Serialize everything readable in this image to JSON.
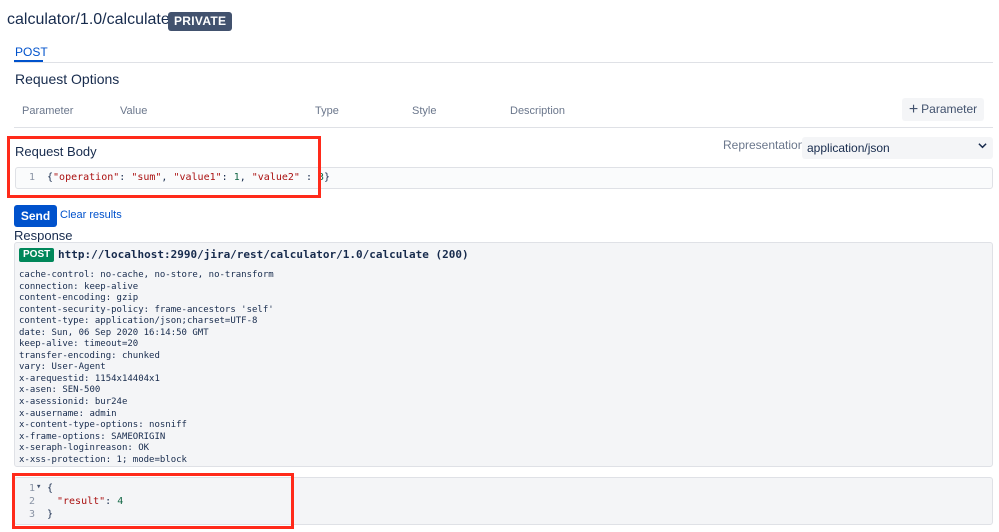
{
  "header": {
    "title": "calculator/1.0/calculate",
    "badge": "PRIVATE"
  },
  "tabs": [
    {
      "label": "POST",
      "active": true
    }
  ],
  "request_options": {
    "title": "Request Options",
    "columns": [
      "Parameter",
      "Value",
      "Type",
      "Style",
      "Description"
    ],
    "add_button": "Parameter"
  },
  "request_body": {
    "title": "Request Body",
    "representation_label": "Representation",
    "representation_value": "application/json",
    "line_number": "1",
    "tokens": {
      "open": "{",
      "k1": "\"operation\"",
      "c1": ": ",
      "v1": "\"sum\"",
      "sep1": ", ",
      "k2": "\"value1\"",
      "c2": ": ",
      "v2": "1",
      "sep2": ", ",
      "k3": "\"value2\"",
      "c3": " : ",
      "v3": "3",
      "close": "}"
    }
  },
  "actions": {
    "send": "Send",
    "clear": "Clear results"
  },
  "response": {
    "title": "Response",
    "method": "POST",
    "url_status": "http://localhost:2990/jira/rest/calculator/1.0/calculate (200)",
    "headers": [
      "cache-control: no-cache, no-store, no-transform",
      "connection: keep-alive",
      "content-encoding: gzip",
      "content-security-policy: frame-ancestors 'self'",
      "content-type: application/json;charset=UTF-8",
      "date: Sun, 06 Sep 2020 16:14:50 GMT",
      "keep-alive: timeout=20",
      "transfer-encoding: chunked",
      "vary: User-Agent",
      "x-arequestid: 1154x14404x1",
      "x-asen: SEN-500",
      "x-asessionid: bur24e",
      "x-ausername: admin",
      "x-content-type-options: nosniff",
      "x-frame-options: SAMEORIGIN",
      "x-seraph-loginreason: OK",
      "x-xss-protection: 1; mode=block"
    ],
    "result": {
      "lines": [
        "1",
        "2",
        "3"
      ],
      "fold_icon": "▾",
      "open": "{",
      "key": "\"result\"",
      "colon": ": ",
      "value": "4",
      "close": "}"
    }
  },
  "colors": {
    "accent": "#0052cc",
    "method_badge": "#00875a",
    "highlight": "#ff2a1a",
    "badge_bg": "#42526e"
  }
}
